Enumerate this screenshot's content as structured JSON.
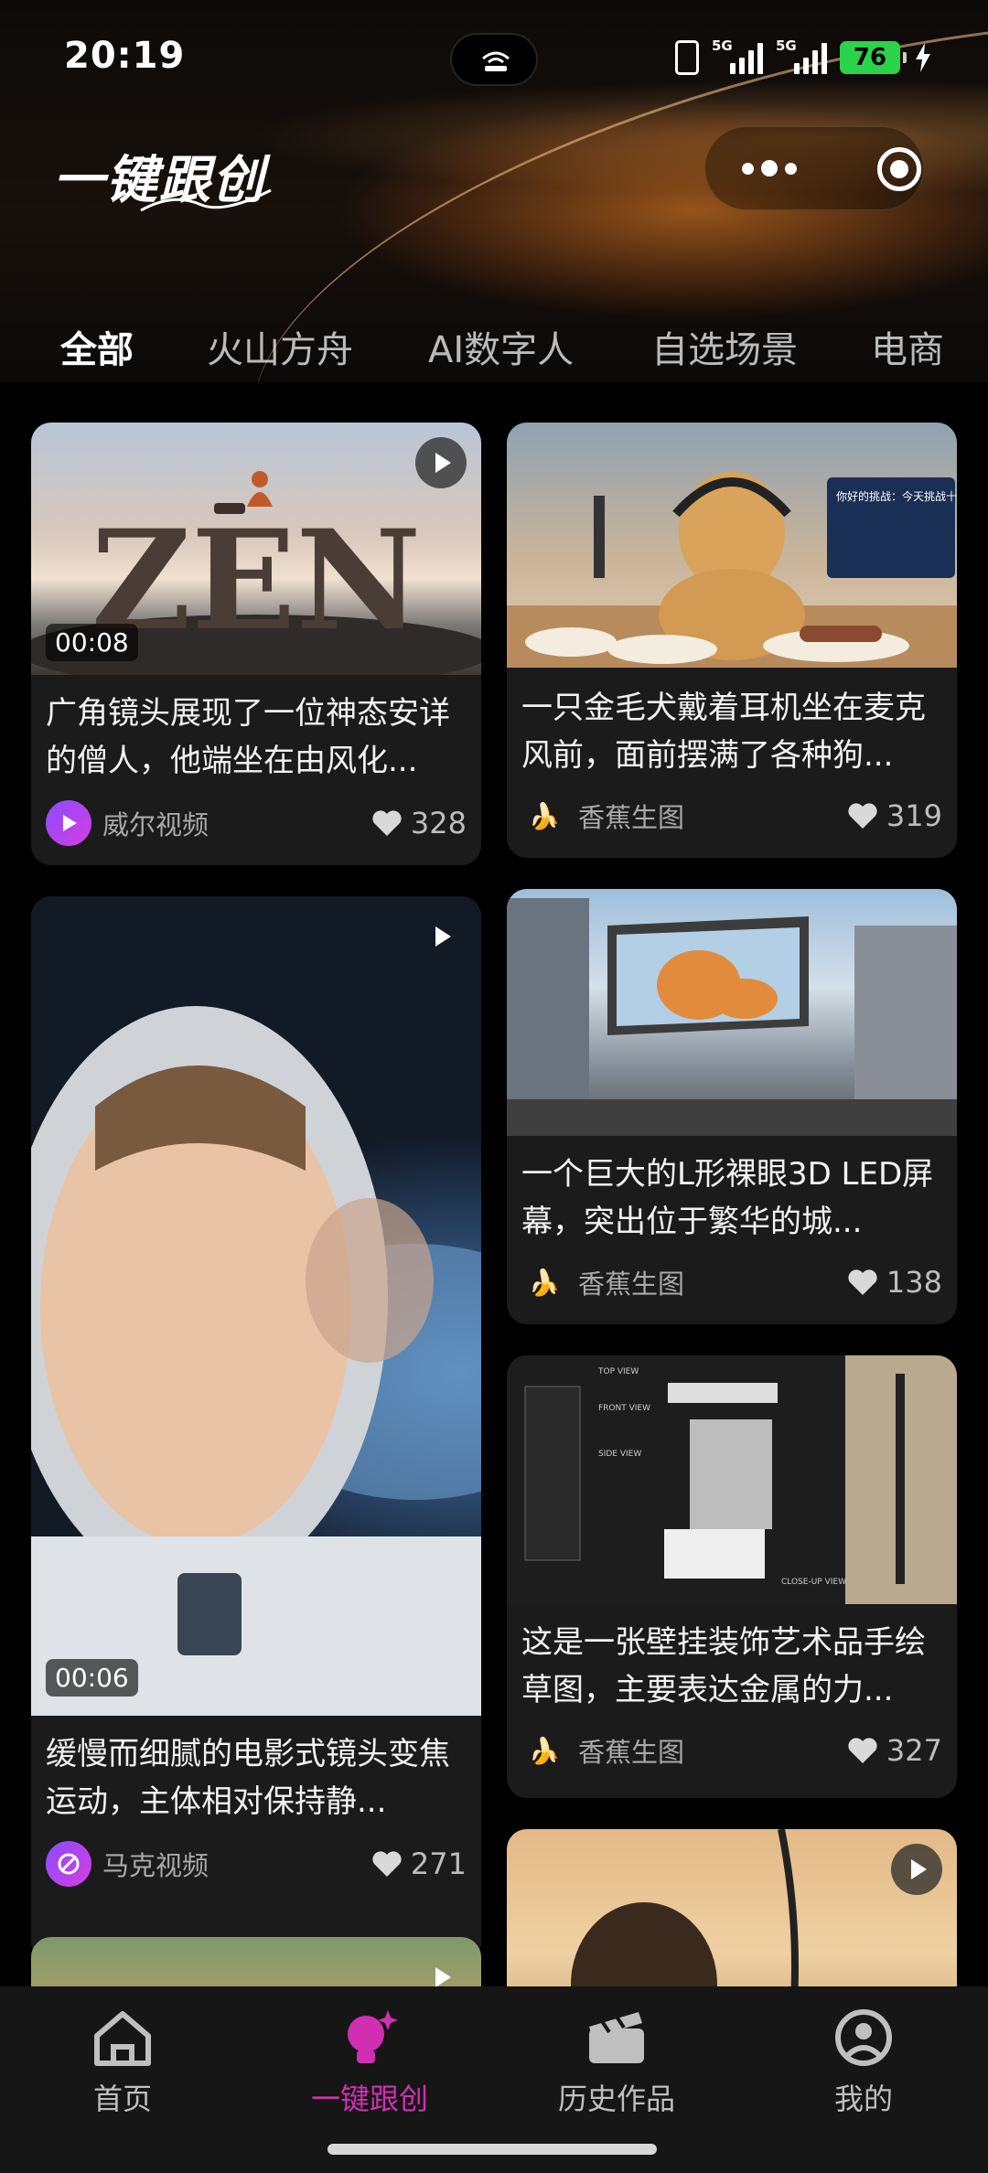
{
  "status_bar": {
    "time": "20:19",
    "network_1": "5G",
    "network_2": "5G",
    "battery": "76"
  },
  "header": {
    "brand_title": "一键跟创",
    "more_icon": "more-dots-icon",
    "target_icon": "record-target-icon"
  },
  "tabs": [
    {
      "label": "全部",
      "active": true
    },
    {
      "label": "火山方舟",
      "active": false
    },
    {
      "label": "AI数字人",
      "active": false
    },
    {
      "label": "自选场景",
      "active": false
    },
    {
      "label": "电商",
      "active": false
    }
  ],
  "cards": [
    {
      "title": "广角镜头展现了一位神态安详的僧人，他端坐在由风化...",
      "duration": "00:08",
      "author": "威尔视频",
      "likes": "328",
      "is_video": true
    },
    {
      "title": "一只金毛犬戴着耳机坐在麦克风前，面前摆满了各种狗...",
      "author": "香蕉生图",
      "likes": "319",
      "is_video": false
    },
    {
      "title": "缓慢而细腻的电影式镜头变焦运动，主体相对保持静...",
      "duration": "00:06",
      "author": "马克视频",
      "likes": "271",
      "is_video": true
    },
    {
      "title": "一个巨大的L形裸眼3D LED屏幕，突出位于繁华的城...",
      "author": "香蕉生图",
      "likes": "138",
      "is_video": false
    },
    {
      "title": "这是一张壁挂装饰艺术品手绘草图，主要表达金属的力...",
      "author": "香蕉生图",
      "likes": "327",
      "is_video": false
    }
  ],
  "thumb_text": {
    "zen_letters": "ZEN",
    "monitor_text": "你好的挑战：今天挑战十根大骨棒！进一大堆的小狗吧！",
    "sketch_labels": [
      "TOP VIEW",
      "FRONT VIEW",
      "SIDE VIEW",
      "CLOSE-UP VIEW"
    ]
  },
  "bottom_nav": [
    {
      "label": "首页",
      "icon": "home-icon",
      "active": false
    },
    {
      "label": "一键跟创",
      "icon": "bulb-sparkle-icon",
      "active": true
    },
    {
      "label": "历史作品",
      "icon": "clapperboard-icon",
      "active": false
    },
    {
      "label": "我的",
      "icon": "profile-icon",
      "active": false
    }
  ],
  "colors": {
    "accent": "#d12fb3",
    "card_bg": "#1b1b1b",
    "battery_green": "#2bd34a"
  }
}
